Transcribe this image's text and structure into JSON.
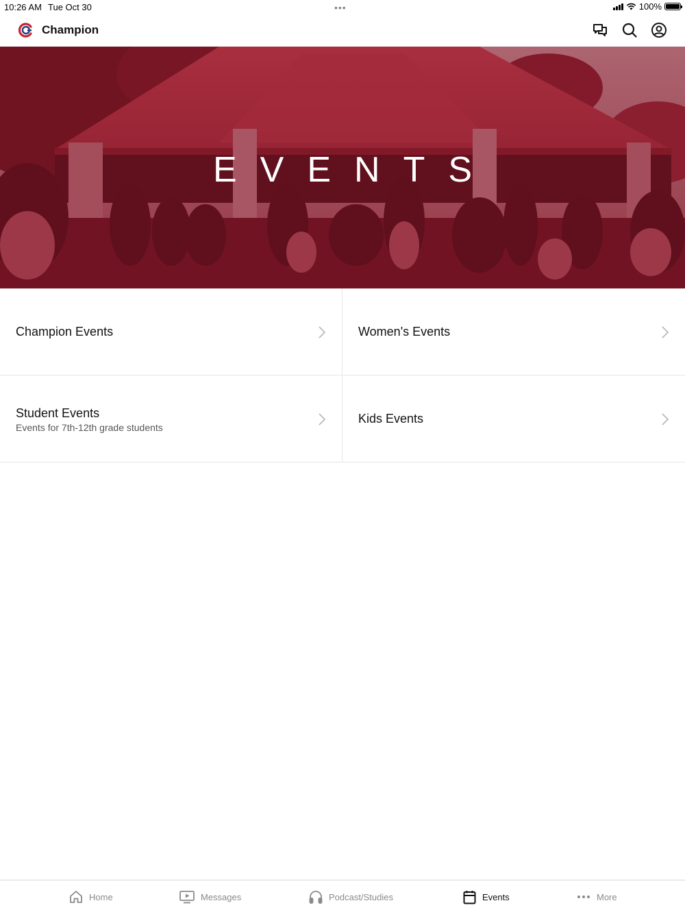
{
  "status_bar": {
    "time": "10:26 AM",
    "date": "Tue Oct 30",
    "grabber": "•••",
    "battery_text": "100%",
    "battery_level": 1.0
  },
  "header": {
    "title": "Champion",
    "logo_icon": "champion-logo-icon",
    "actions": [
      {
        "icon": "chat-icon"
      },
      {
        "icon": "search-icon"
      },
      {
        "icon": "profile-icon"
      }
    ]
  },
  "hero": {
    "title": "EVENTS",
    "tint_color": "#8b1a2c"
  },
  "categories": [
    {
      "title": "Champion Events",
      "subtitle": ""
    },
    {
      "title": "Women's Events",
      "subtitle": ""
    },
    {
      "title": "Student Events",
      "subtitle": "Events for 7th-12th grade students"
    },
    {
      "title": "Kids Events",
      "subtitle": ""
    }
  ],
  "tab_bar": {
    "tabs": [
      {
        "label": "Home",
        "icon": "home-icon",
        "active": false
      },
      {
        "label": "Messages",
        "icon": "video-icon",
        "active": false
      },
      {
        "label": "Podcast/Studies",
        "icon": "headphones-icon",
        "active": false
      },
      {
        "label": "Events",
        "icon": "calendar-icon",
        "active": true
      },
      {
        "label": "More",
        "icon": "more-icon",
        "active": false
      }
    ]
  }
}
